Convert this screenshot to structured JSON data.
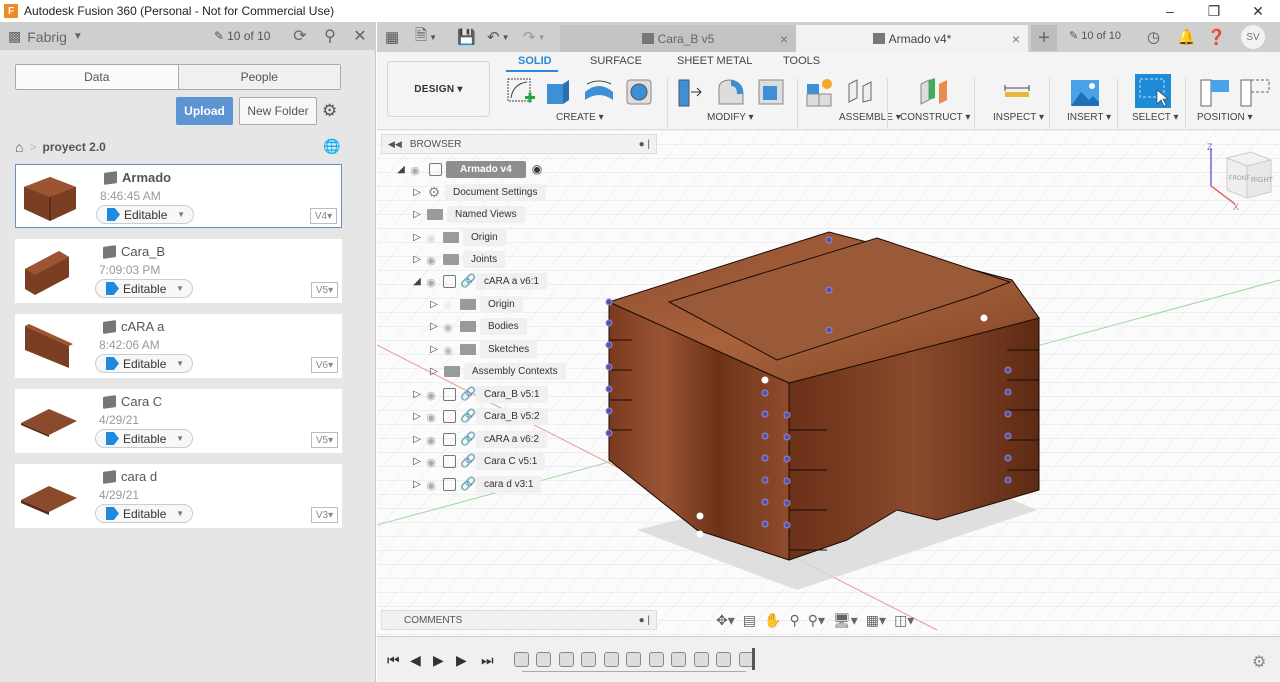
{
  "window": {
    "title": "Autodesk Fusion 360 (Personal - Not for Commercial Use)",
    "app_icon": "F",
    "controls": {
      "minimize": "–",
      "maximize": "❐",
      "close": "✕"
    }
  },
  "data_panel": {
    "team": "Fabrig",
    "count": "10 of 10",
    "tabs": [
      "Data",
      "People"
    ],
    "upload_label": "Upload",
    "new_folder_label": "New Folder",
    "breadcrumb": {
      "home": "home",
      "project": "proyect 2.0"
    },
    "files": [
      {
        "name": "Armado",
        "date": "8:46:45 AM",
        "status": "Editable",
        "version": "V4",
        "selected": true
      },
      {
        "name": "Cara_B",
        "date": "7:09:03 PM",
        "status": "Editable",
        "version": "V5",
        "selected": false
      },
      {
        "name": "cARA a",
        "date": "8:42:06 AM",
        "status": "Editable",
        "version": "V6",
        "selected": false
      },
      {
        "name": "Cara C",
        "date": "4/29/21",
        "status": "Editable",
        "version": "V5",
        "selected": false
      },
      {
        "name": "cara d",
        "date": "4/29/21",
        "status": "Editable",
        "version": "V3",
        "selected": false
      }
    ]
  },
  "top_bar": {
    "tabs": [
      {
        "label": "Cara_B v5",
        "active": false
      },
      {
        "label": "Armado v4*",
        "active": true
      }
    ],
    "count": "10 of 10",
    "user_initials": "SV"
  },
  "ribbon": {
    "workspace": "DESIGN ▾",
    "tabs": [
      "SOLID",
      "SURFACE",
      "SHEET METAL",
      "TOOLS"
    ],
    "active_tab": "SOLID",
    "groups": [
      "CREATE ▾",
      "MODIFY ▾",
      "ASSEMBLE ▾",
      "CONSTRUCT ▾",
      "INSPECT ▾",
      "INSERT ▾",
      "SELECT ▾",
      "POSITION ▾"
    ]
  },
  "browser": {
    "title": "BROWSER",
    "root": "Armado v4",
    "items": [
      {
        "label": "Document Settings",
        "type": "settings",
        "level": 1
      },
      {
        "label": "Named Views",
        "type": "folder",
        "level": 1
      },
      {
        "label": "Origin",
        "type": "folder",
        "level": 1,
        "hidden": true
      },
      {
        "label": "Joints",
        "type": "folder",
        "level": 1
      },
      {
        "label": "cARA a v6:1",
        "type": "component",
        "level": 1,
        "expanded": true
      },
      {
        "label": "Origin",
        "type": "folder",
        "level": 2,
        "hidden": true
      },
      {
        "label": "Bodies",
        "type": "folder",
        "level": 2
      },
      {
        "label": "Sketches",
        "type": "folder",
        "level": 2
      },
      {
        "label": "Assembly Contexts",
        "type": "folder",
        "level": 2
      },
      {
        "label": "Cara_B v5:1",
        "type": "component",
        "level": 1
      },
      {
        "label": "Cara_B v5:2",
        "type": "component",
        "level": 1
      },
      {
        "label": "cARA a v6:2",
        "type": "component",
        "level": 1
      },
      {
        "label": "Cara C v5:1",
        "type": "component",
        "level": 1
      },
      {
        "label": "cara d v3:1",
        "type": "component",
        "level": 1
      }
    ]
  },
  "comments": {
    "title": "COMMENTS"
  },
  "viewcube": {
    "z_label": "Z",
    "x_label": "X",
    "faces": [
      "FRONT",
      "RIGHT"
    ]
  },
  "colors": {
    "accent": "#2b88d8",
    "upload": "#5c95d1",
    "wood": "#8a4a2c"
  }
}
